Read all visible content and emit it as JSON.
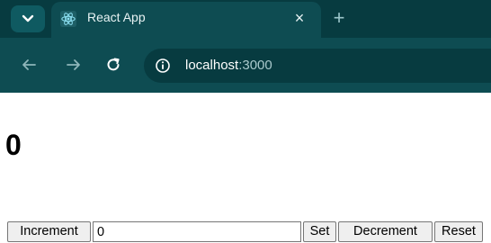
{
  "browser": {
    "tab": {
      "title": "React App",
      "close_icon": "close-icon",
      "favicon": "react-logo-icon"
    },
    "new_tab_icon": "plus-icon",
    "toolbar": {
      "back_icon": "arrow-left-icon",
      "forward_icon": "arrow-right-icon",
      "reload_icon": "reload-icon",
      "site_info_icon": "info-icon"
    },
    "address": {
      "host": "localhost",
      "port": ":3000"
    }
  },
  "app": {
    "count": "0",
    "controls": {
      "increment_label": "Increment",
      "input_value": "0",
      "set_label": "Set",
      "decrement_label": "Decrement",
      "reset_label": "Reset"
    }
  },
  "colors": {
    "chrome_bg": "#0e4c52",
    "tabstrip_bg": "#073b40",
    "page_bg": "#ffffff"
  }
}
